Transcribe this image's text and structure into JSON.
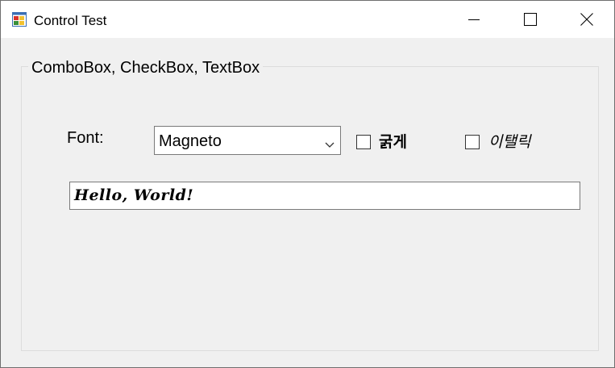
{
  "window": {
    "title": "Control Test",
    "icons": {
      "app": "app-window-icon",
      "minimize": "minimize-icon",
      "maximize": "maximize-icon",
      "close": "close-icon"
    }
  },
  "group": {
    "title": "ComboBox, CheckBox, TextBox"
  },
  "font_row": {
    "label": "Font:",
    "combo_value": "Magneto",
    "combo_arrow_icon": "chevron-down-icon"
  },
  "checkboxes": [
    {
      "label": "굵게",
      "checked": false
    },
    {
      "label": "이탤릭",
      "checked": false
    }
  ],
  "textbox": {
    "value": "Hello, World!"
  }
}
